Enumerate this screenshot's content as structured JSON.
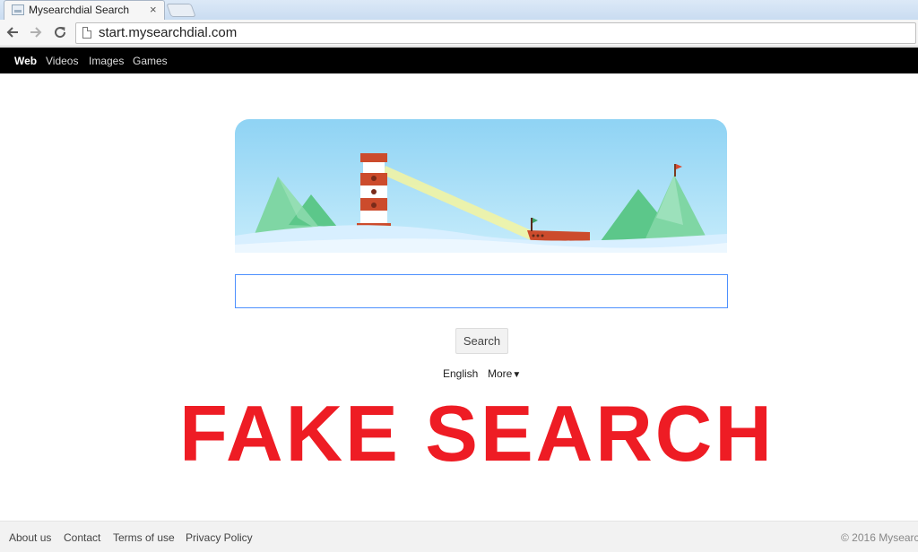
{
  "browser": {
    "tab_title": "Mysearchdial Search",
    "tab_close": "×",
    "url": "start.mysearchdial.com"
  },
  "icons": {
    "back": "back-arrow-icon",
    "forward": "forward-arrow-icon",
    "reload": "reload-icon",
    "page": "page-icon",
    "favicon": "favicon-icon"
  },
  "site_nav": {
    "items": [
      {
        "label": "Web",
        "active": true
      },
      {
        "label": "Videos",
        "active": false
      },
      {
        "label": "Images",
        "active": false
      },
      {
        "label": "Games",
        "active": false
      }
    ]
  },
  "search": {
    "value": "",
    "button_label": "Search"
  },
  "language": {
    "current": "English",
    "more_label": "More",
    "more_arrow": "▼"
  },
  "overlay": {
    "text": "FAKE SEARCH",
    "color": "#ee1c24"
  },
  "footer": {
    "links": [
      "About us",
      "Contact",
      "Terms of use",
      "Privacy Policy"
    ],
    "copyright": "© 2016 Mysearc"
  },
  "colors": {
    "nav_bg": "#000000",
    "input_border": "#4d90fe",
    "sky": "#a9dcf5"
  }
}
